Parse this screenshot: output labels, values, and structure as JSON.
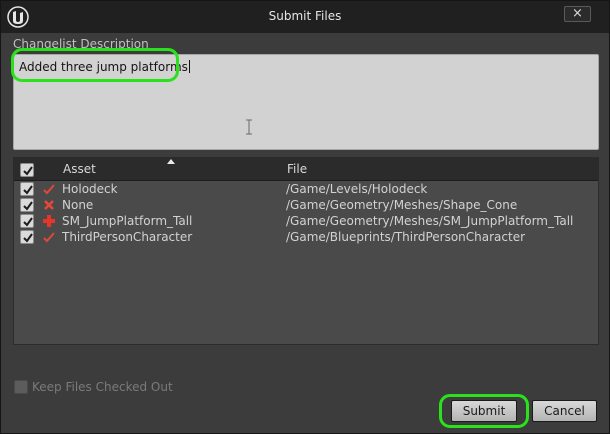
{
  "window": {
    "title": "Submit Files",
    "close_label": "×"
  },
  "description": {
    "label": "Changelist Description",
    "value": "Added three jump platforms"
  },
  "table": {
    "header_checked": true,
    "columns": [
      "Asset",
      "File"
    ],
    "sort_column": "Asset",
    "rows": [
      {
        "checked": true,
        "status": "edit-check-icon",
        "asset": "Holodeck",
        "file": "/Game/Levels/Holodeck"
      },
      {
        "checked": true,
        "status": "delete-x-icon",
        "asset": "None",
        "file": "/Game/Geometry/Meshes/Shape_Cone"
      },
      {
        "checked": true,
        "status": "add-plus-icon",
        "asset": "SM_JumpPlatform_Tall",
        "file": "/Game/Geometry/Meshes/SM_JumpPlatform_Tall"
      },
      {
        "checked": true,
        "status": "edit-check-icon",
        "asset": "ThirdPersonCharacter",
        "file": "/Game/Blueprints/ThirdPersonCharacter"
      }
    ]
  },
  "keep_checked_out": {
    "label": "Keep Files Checked Out",
    "checked": false,
    "enabled": false
  },
  "buttons": {
    "submit": "Submit",
    "cancel": "Cancel"
  },
  "colors": {
    "highlight": "#2ae21b",
    "check_red": "#e0483a",
    "delete_red": "#e8483a",
    "add_red": "#e8342a"
  }
}
